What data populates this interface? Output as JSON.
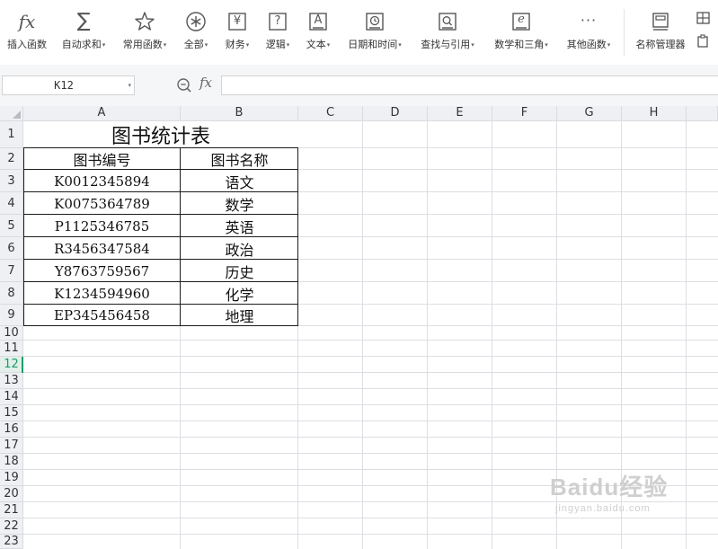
{
  "ribbon": {
    "buttons": [
      {
        "label": "插入函数",
        "caret": false,
        "icon": "fx-icon"
      },
      {
        "label": "自动求和",
        "caret": true,
        "icon": "sigma-icon"
      },
      {
        "label": "常用函数",
        "caret": true,
        "icon": "star-icon"
      },
      {
        "label": "全部",
        "caret": true,
        "icon": "asterisk-icon"
      },
      {
        "label": "财务",
        "caret": true,
        "icon": "yen-icon"
      },
      {
        "label": "逻辑",
        "caret": true,
        "icon": "question-icon"
      },
      {
        "label": "文本",
        "caret": true,
        "icon": "text-a-icon"
      },
      {
        "label": "日期和时间",
        "caret": true,
        "icon": "clock-icon"
      },
      {
        "label": "查找与引用",
        "caret": true,
        "icon": "lookup-icon"
      },
      {
        "label": "数学和三角",
        "caret": true,
        "icon": "math-icon"
      },
      {
        "label": "其他函数",
        "caret": true,
        "icon": "more-icon"
      },
      {
        "label": "名称管理器",
        "caret": false,
        "icon": "name-manager-icon"
      }
    ],
    "caret_glyph": "▾",
    "fx_glyph": "fx",
    "sigma_glyph": "∑",
    "yen_glyph": "¥",
    "question_glyph": "?",
    "text_a_glyph": "A",
    "math_glyph": "e",
    "more_glyph": "···"
  },
  "formula_bar": {
    "name_box": "K12",
    "fx_label": "fx",
    "formula": ""
  },
  "sheet": {
    "columns": [
      "A",
      "B",
      "C",
      "D",
      "E",
      "F",
      "G",
      "H"
    ],
    "rows": [
      "1",
      "2",
      "3",
      "4",
      "5",
      "6",
      "7",
      "8",
      "9",
      "10",
      "11",
      "12",
      "13",
      "14",
      "15",
      "16",
      "17",
      "18",
      "19",
      "20",
      "21",
      "22",
      "23"
    ],
    "active_row": "12",
    "title": "图书统计表",
    "headers": {
      "code": "图书编号",
      "name": "图书名称"
    },
    "records": [
      {
        "code": "K0012345894",
        "name": "语文"
      },
      {
        "code": "K0075364789",
        "name": "数学"
      },
      {
        "code": "P1125346785",
        "name": "英语"
      },
      {
        "code": "R3456347584",
        "name": "政治"
      },
      {
        "code": "Y8763759567",
        "name": "历史"
      },
      {
        "code": "K1234594960",
        "name": "化学"
      },
      {
        "code": "EP345456458",
        "name": "地理"
      }
    ]
  },
  "watermark": {
    "brand": "Baidu经验",
    "sub": "jingyan.baidu.com"
  },
  "colors": {
    "accent": "#1a9c6a",
    "gridline": "#dcdee3",
    "header_bg": "#eef0f3"
  }
}
